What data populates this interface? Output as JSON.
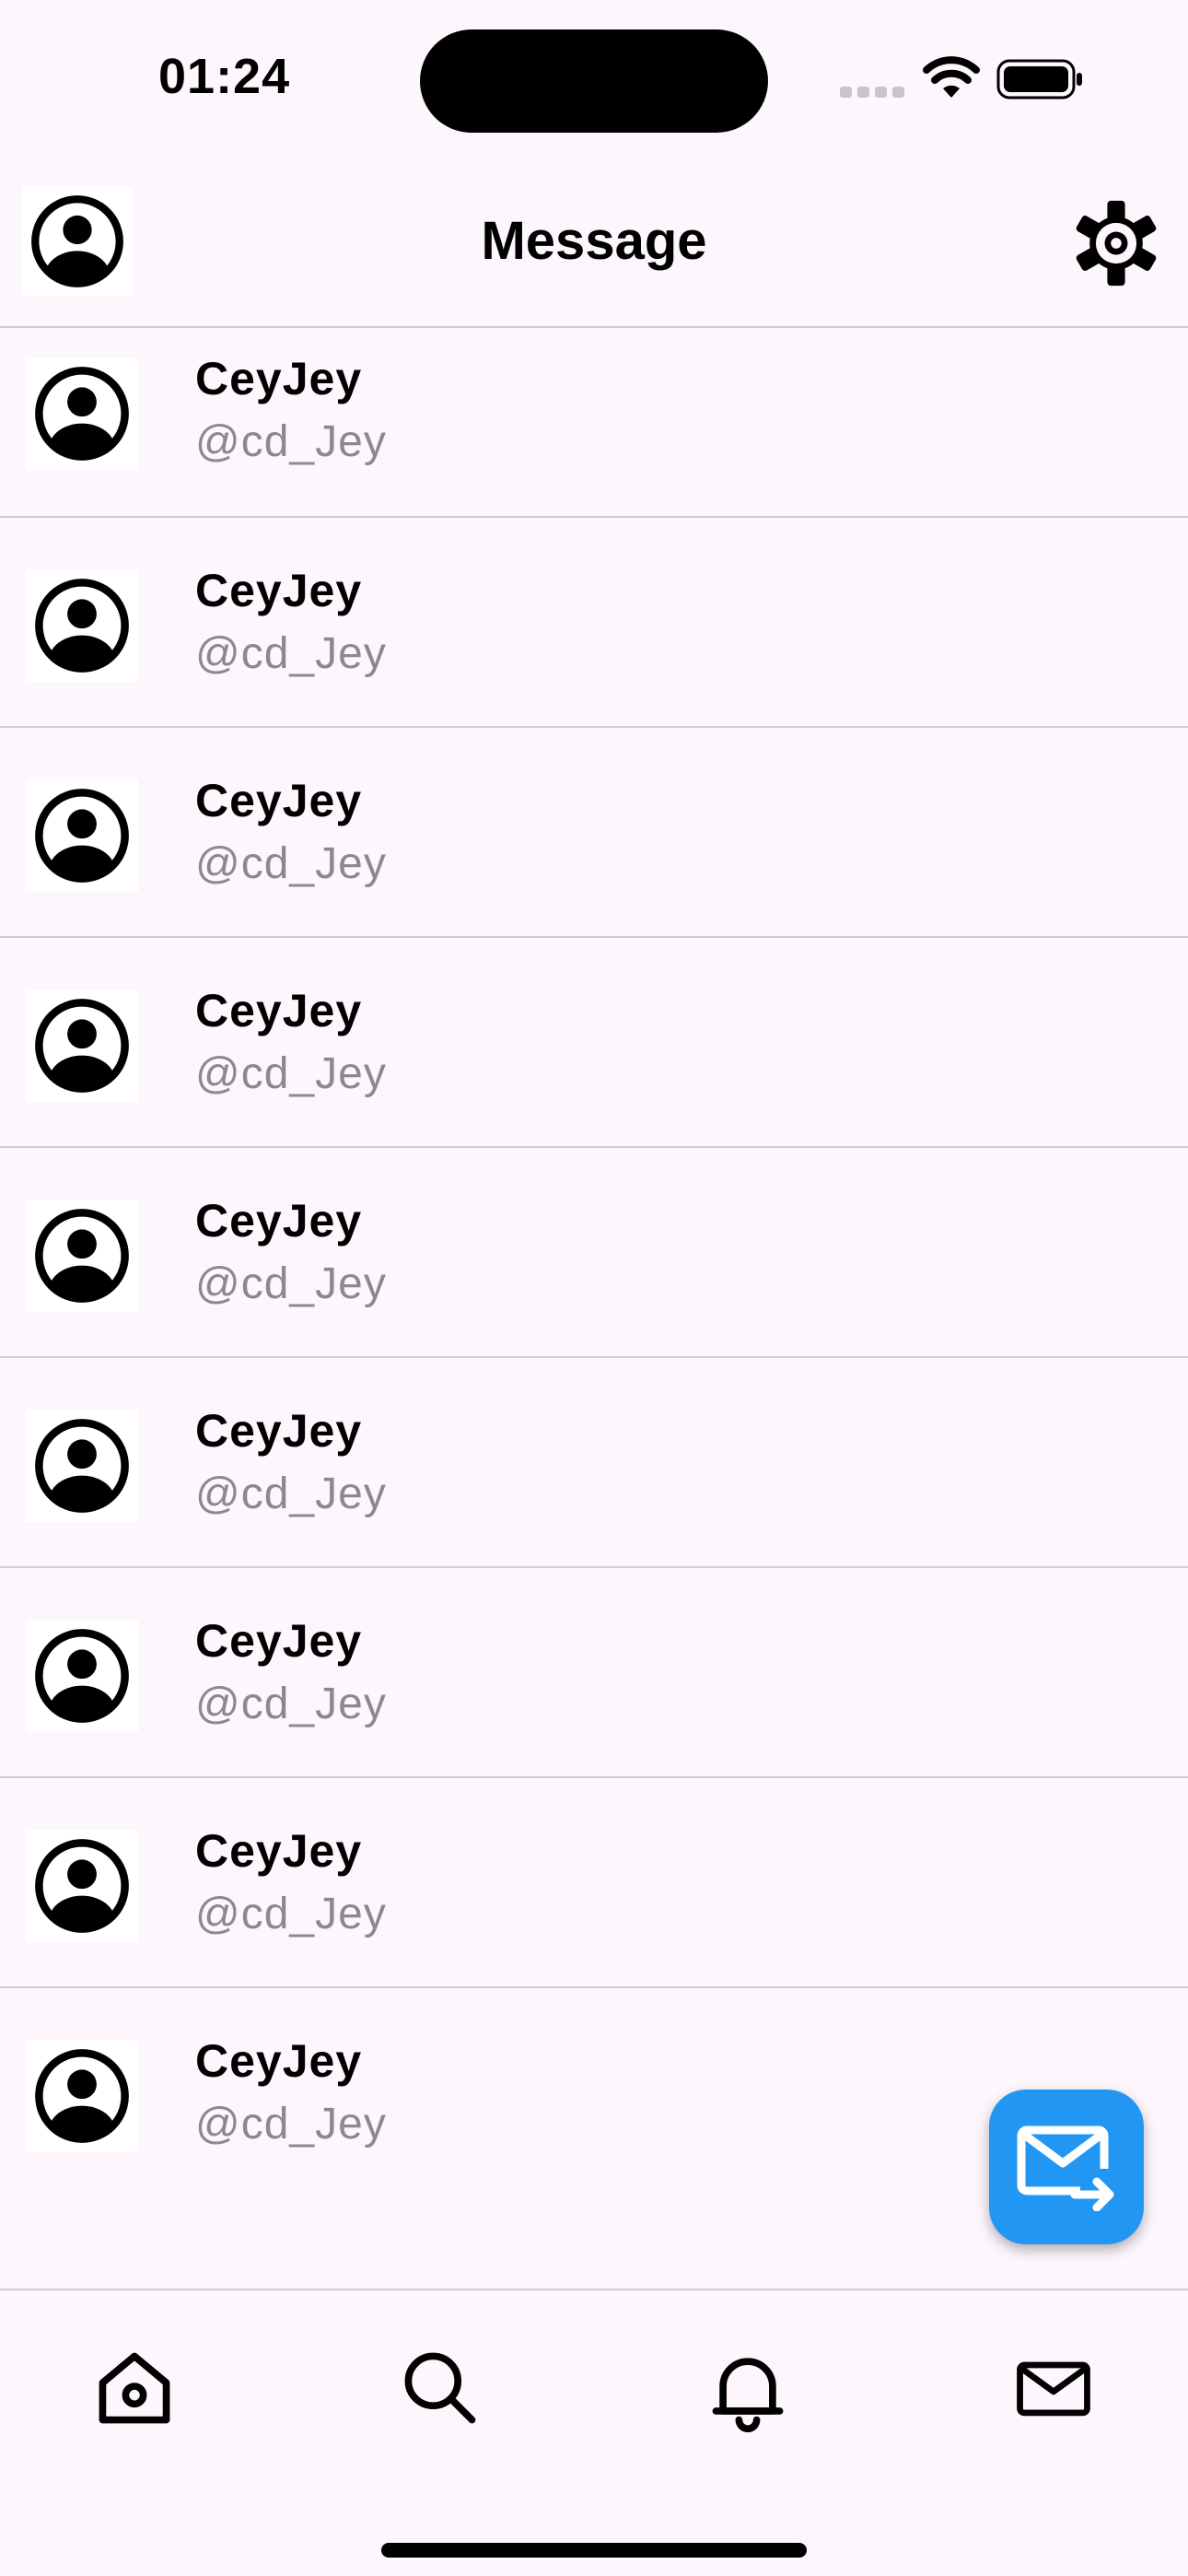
{
  "status_bar": {
    "time": "01:24"
  },
  "header": {
    "title": "Message"
  },
  "messages": [
    {
      "name": "CeyJey",
      "handle": "@cd_Jey"
    },
    {
      "name": "CeyJey",
      "handle": "@cd_Jey"
    },
    {
      "name": "CeyJey",
      "handle": "@cd_Jey"
    },
    {
      "name": "CeyJey",
      "handle": "@cd_Jey"
    },
    {
      "name": "CeyJey",
      "handle": "@cd_Jey"
    },
    {
      "name": "CeyJey",
      "handle": "@cd_Jey"
    },
    {
      "name": "CeyJey",
      "handle": "@cd_Jey"
    },
    {
      "name": "CeyJey",
      "handle": "@cd_Jey"
    },
    {
      "name": "CeyJey",
      "handle": "@cd_Jey"
    }
  ],
  "icons": {
    "profile": "account-circle-icon",
    "settings": "gear-icon",
    "compose": "mail-forward-icon",
    "nav": [
      "home-icon",
      "search-icon",
      "bell-icon",
      "mail-icon"
    ]
  },
  "colors": {
    "background": "#fdf7fd",
    "accent": "#2196f3",
    "handle_text": "#8a8a8e",
    "divider": "#cfcbd0"
  }
}
